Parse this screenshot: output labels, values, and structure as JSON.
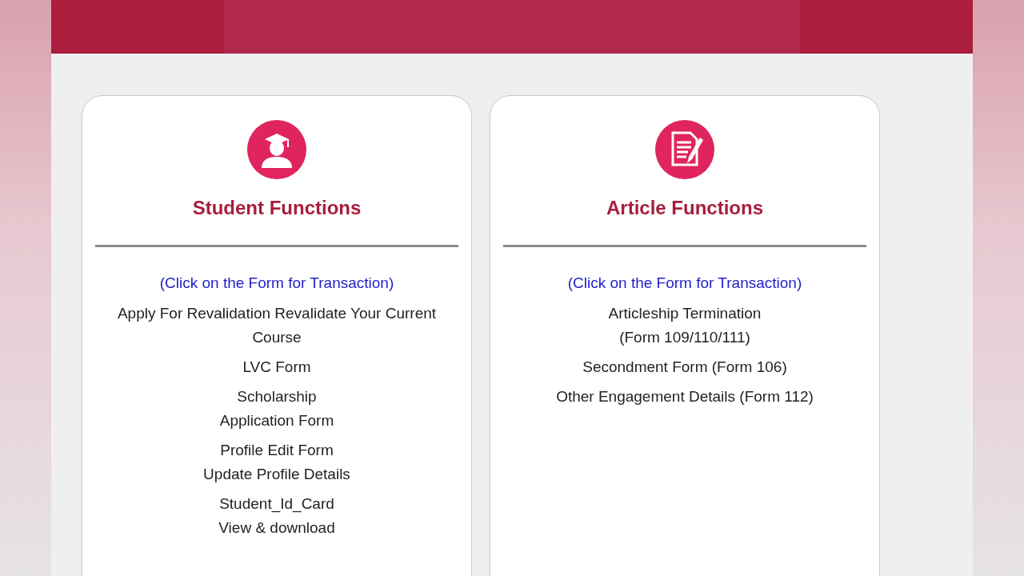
{
  "cards": [
    {
      "kind": "student",
      "title": "Student Functions",
      "hint": "(Click on the Form for Transaction)",
      "items": [
        {
          "lines": [
            "Apply For Revalidation Revalidate Your Current Course"
          ]
        },
        {
          "lines": [
            "LVC Form"
          ]
        },
        {
          "lines": [
            "Scholarship",
            "Application Form"
          ]
        },
        {
          "lines": [
            "Profile Edit Form",
            "Update Profile Details"
          ]
        },
        {
          "lines": [
            "Student_Id_Card",
            "View & download"
          ]
        }
      ]
    },
    {
      "kind": "article",
      "title": "Article Functions",
      "hint": "(Click on the Form for Transaction)",
      "items": [
        {
          "lines": [
            "Articleship Termination",
            "(Form 109/110/111)"
          ]
        },
        {
          "lines": [
            "Secondment Form (Form 106)"
          ]
        },
        {
          "lines": [
            "Other Engagement Details (Form 112)"
          ]
        }
      ]
    }
  ]
}
